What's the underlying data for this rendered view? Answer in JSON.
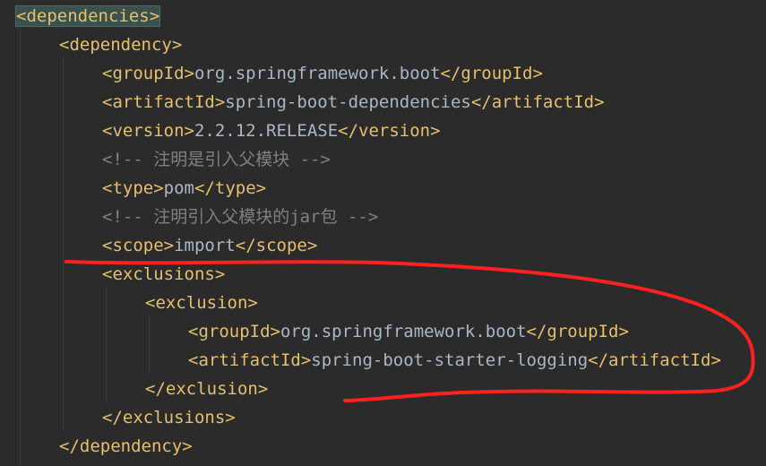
{
  "code": {
    "l1": {
      "lt": "<",
      "tag": "dependencies",
      "gt": ">"
    },
    "l2": {
      "lt": "<",
      "tag": "dependency",
      "gt": ">"
    },
    "l3": {
      "open_lt": "<",
      "open_tag": "groupId",
      "open_gt": ">",
      "value": "org.springframework.boot",
      "close_lt": "</",
      "close_tag": "groupId",
      "close_gt": ">"
    },
    "l4": {
      "open_lt": "<",
      "open_tag": "artifactId",
      "open_gt": ">",
      "value": "spring-boot-dependencies",
      "close_lt": "</",
      "close_tag": "artifactId",
      "close_gt": ">"
    },
    "l5": {
      "open_lt": "<",
      "open_tag": "version",
      "open_gt": ">",
      "value": "2.2.12.RELEASE",
      "close_lt": "</",
      "close_tag": "version",
      "close_gt": ">"
    },
    "l6": {
      "comment": "<!-- 注明是引入父模块 -->"
    },
    "l7": {
      "open_lt": "<",
      "open_tag": "type",
      "open_gt": ">",
      "value": "pom",
      "close_lt": "</",
      "close_tag": "type",
      "close_gt": ">"
    },
    "l8": {
      "comment": "<!-- 注明引入父模块的jar包 -->"
    },
    "l9": {
      "open_lt": "<",
      "open_tag": "scope",
      "open_gt": ">",
      "value": "import",
      "close_lt": "</",
      "close_tag": "scope",
      "close_gt": ">"
    },
    "l10": {
      "lt": "<",
      "tag": "exclusions",
      "gt": ">"
    },
    "l11": {
      "lt": "<",
      "tag": "exclusion",
      "gt": ">"
    },
    "l12": {
      "open_lt": "<",
      "open_tag": "groupId",
      "open_gt": ">",
      "value": "org.springframework.boot",
      "close_lt": "</",
      "close_tag": "groupId",
      "close_gt": ">"
    },
    "l13": {
      "open_lt": "<",
      "open_tag": "artifactId",
      "open_gt": ">",
      "value": "spring-boot-starter-logging",
      "close_lt": "</",
      "close_tag": "artifactId",
      "close_gt": ">"
    },
    "l14": {
      "lt": "</",
      "tag": "exclusion",
      "gt": ">"
    },
    "l15": {
      "lt": "</",
      "tag": "exclusions",
      "gt": ">"
    },
    "l16": {
      "lt": "</",
      "tag": "dependency",
      "gt": ">"
    }
  },
  "colors": {
    "background": "#2b2b2b",
    "tag": "#e8bf6a",
    "text": "#a9b7c6",
    "comment": "#808080",
    "bracket_highlight": "#3b514d",
    "annotation": "#ff2020"
  }
}
